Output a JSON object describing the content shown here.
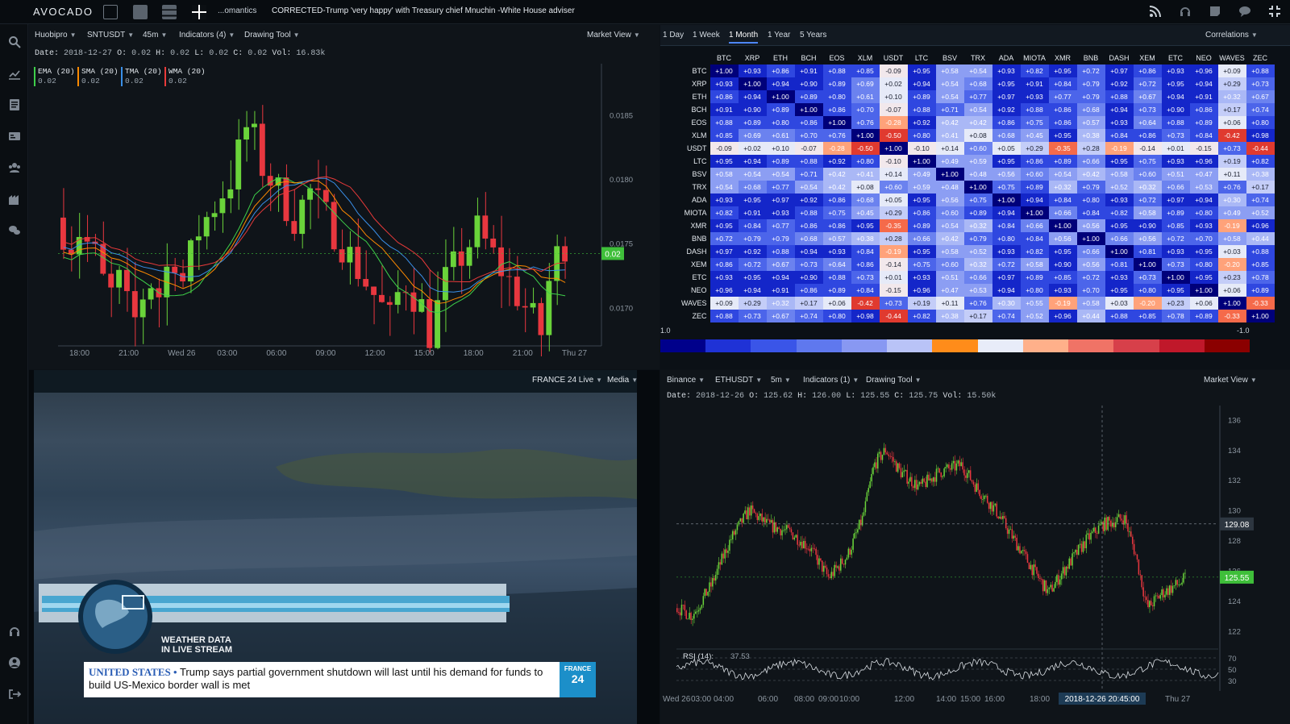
{
  "app": {
    "logo": "AVOCADO"
  },
  "topbar": {
    "news_source": "...omantics",
    "news_headline": "CORRECTED-Trump 'very happy' with Treasury chief Mnuchin -White House adviser"
  },
  "top_left_chart": {
    "exchange": "Huobipro",
    "pair": "SNTUSDT",
    "interval": "45m",
    "indicators": "Indicators (4)",
    "drawing_tool": "Drawing Tool",
    "view": "Market View",
    "ohlc": {
      "date_label": "Date:",
      "date": "2018-12-27",
      "o_label": "O:",
      "o": "0.02",
      "h_label": "H:",
      "h": "0.02",
      "l_label": "L:",
      "l": "0.02",
      "c_label": "C:",
      "c": "0.02",
      "vol_label": "Vol:",
      "vol": "16.83k"
    },
    "legend": [
      {
        "name": "EMA (20)",
        "value": "0.02",
        "color": "#3ecf4a"
      },
      {
        "name": "SMA (20)",
        "value": "0.02",
        "color": "#ff8a00"
      },
      {
        "name": "TMA (20)",
        "value": "0.02",
        "color": "#3a8fe8"
      },
      {
        "name": "WMA (20)",
        "value": "0.02",
        "color": "#e83a3a"
      }
    ],
    "price_labels": [
      "0.0185",
      "0.0180",
      "0.0175",
      "0.0170"
    ],
    "current_price": "0.02",
    "time_labels": [
      "18:00",
      "21:00",
      "Wed 26",
      "03:00",
      "06:00",
      "09:00",
      "12:00",
      "15:00",
      "18:00",
      "21:00",
      "Thu 27"
    ]
  },
  "correlation": {
    "timeframes": [
      "1 Day",
      "1 Week",
      "1 Month",
      "1 Year",
      "5 Years"
    ],
    "active_timeframe": "1 Month",
    "view": "Correlations",
    "symbols": [
      "BTC",
      "XRP",
      "ETH",
      "BCH",
      "EOS",
      "XLM",
      "USDT",
      "LTC",
      "BSV",
      "TRX",
      "ADA",
      "MIOTA",
      "XMR",
      "BNB",
      "DASH",
      "XEM",
      "ETC",
      "NEO",
      "WAVES",
      "ZEC"
    ],
    "matrix": [
      [
        "+1.00",
        "+0.93",
        "+0.86",
        "+0.91",
        "+0.88",
        "+0.85",
        "-0.09",
        "+0.95",
        "+0.58",
        "+0.54",
        "+0.93",
        "+0.82",
        "+0.95",
        "+0.72",
        "+0.97",
        "+0.86",
        "+0.93",
        "+0.96",
        "+0.09",
        "+0.88"
      ],
      [
        "+0.93",
        "+1.00",
        "+0.94",
        "+0.90",
        "+0.89",
        "+0.69",
        "+0.02",
        "+0.94",
        "+0.54",
        "+0.68",
        "+0.95",
        "+0.91",
        "+0.84",
        "+0.79",
        "+0.92",
        "+0.72",
        "+0.95",
        "+0.94",
        "+0.29",
        "+0.73"
      ],
      [
        "+0.86",
        "+0.94",
        "+1.00",
        "+0.89",
        "+0.80",
        "+0.61",
        "+0.10",
        "+0.89",
        "+0.54",
        "+0.77",
        "+0.97",
        "+0.93",
        "+0.77",
        "+0.79",
        "+0.88",
        "+0.67",
        "+0.94",
        "+0.91",
        "+0.32",
        "+0.67"
      ],
      [
        "+0.91",
        "+0.90",
        "+0.89",
        "+1.00",
        "+0.86",
        "+0.70",
        "-0.07",
        "+0.88",
        "+0.71",
        "+0.54",
        "+0.92",
        "+0.88",
        "+0.86",
        "+0.68",
        "+0.94",
        "+0.73",
        "+0.90",
        "+0.86",
        "+0.17",
        "+0.74"
      ],
      [
        "+0.88",
        "+0.89",
        "+0.80",
        "+0.86",
        "+1.00",
        "+0.76",
        "-0.28",
        "+0.92",
        "+0.42",
        "+0.42",
        "+0.86",
        "+0.75",
        "+0.86",
        "+0.57",
        "+0.93",
        "+0.64",
        "+0.88",
        "+0.89",
        "+0.06",
        "+0.80"
      ],
      [
        "+0.85",
        "+0.69",
        "+0.61",
        "+0.70",
        "+0.76",
        "+1.00",
        "-0.50",
        "+0.80",
        "+0.41",
        "+0.08",
        "+0.68",
        "+0.45",
        "+0.95",
        "+0.38",
        "+0.84",
        "+0.86",
        "+0.73",
        "+0.84",
        "-0.42",
        "+0.98"
      ],
      [
        "-0.09",
        "+0.02",
        "+0.10",
        "-0.07",
        "-0.28",
        "-0.50",
        "+1.00",
        "-0.10",
        "+0.14",
        "+0.60",
        "+0.05",
        "+0.29",
        "-0.35",
        "+0.28",
        "-0.19",
        "-0.14",
        "+0.01",
        "-0.15",
        "+0.73",
        "-0.44"
      ],
      [
        "+0.95",
        "+0.94",
        "+0.89",
        "+0.88",
        "+0.92",
        "+0.80",
        "-0.10",
        "+1.00",
        "+0.49",
        "+0.59",
        "+0.95",
        "+0.86",
        "+0.89",
        "+0.66",
        "+0.95",
        "+0.75",
        "+0.93",
        "+0.96",
        "+0.19",
        "+0.82"
      ],
      [
        "+0.58",
        "+0.54",
        "+0.54",
        "+0.71",
        "+0.42",
        "+0.41",
        "+0.14",
        "+0.49",
        "+1.00",
        "+0.48",
        "+0.56",
        "+0.60",
        "+0.54",
        "+0.42",
        "+0.58",
        "+0.60",
        "+0.51",
        "+0.47",
        "+0.11",
        "+0.38"
      ],
      [
        "+0.54",
        "+0.68",
        "+0.77",
        "+0.54",
        "+0.42",
        "+0.08",
        "+0.60",
        "+0.59",
        "+0.48",
        "+1.00",
        "+0.75",
        "+0.89",
        "+0.32",
        "+0.79",
        "+0.52",
        "+0.32",
        "+0.66",
        "+0.53",
        "+0.76",
        "+0.17"
      ],
      [
        "+0.93",
        "+0.95",
        "+0.97",
        "+0.92",
        "+0.86",
        "+0.68",
        "+0.05",
        "+0.95",
        "+0.56",
        "+0.75",
        "+1.00",
        "+0.94",
        "+0.84",
        "+0.80",
        "+0.93",
        "+0.72",
        "+0.97",
        "+0.94",
        "+0.30",
        "+0.74"
      ],
      [
        "+0.82",
        "+0.91",
        "+0.93",
        "+0.88",
        "+0.75",
        "+0.45",
        "+0.29",
        "+0.86",
        "+0.60",
        "+0.89",
        "+0.94",
        "+1.00",
        "+0.66",
        "+0.84",
        "+0.82",
        "+0.58",
        "+0.89",
        "+0.80",
        "+0.49",
        "+0.52"
      ],
      [
        "+0.95",
        "+0.84",
        "+0.77",
        "+0.86",
        "+0.86",
        "+0.95",
        "-0.35",
        "+0.89",
        "+0.54",
        "+0.32",
        "+0.84",
        "+0.66",
        "+1.00",
        "+0.56",
        "+0.95",
        "+0.90",
        "+0.85",
        "+0.93",
        "-0.19",
        "+0.96"
      ],
      [
        "+0.72",
        "+0.79",
        "+0.79",
        "+0.68",
        "+0.57",
        "+0.38",
        "+0.28",
        "+0.66",
        "+0.42",
        "+0.79",
        "+0.80",
        "+0.84",
        "+0.56",
        "+1.00",
        "+0.66",
        "+0.56",
        "+0.72",
        "+0.70",
        "+0.58",
        "+0.44"
      ],
      [
        "+0.97",
        "+0.92",
        "+0.88",
        "+0.94",
        "+0.93",
        "+0.84",
        "-0.19",
        "+0.95",
        "+0.58",
        "+0.52",
        "+0.93",
        "+0.82",
        "+0.95",
        "+0.66",
        "+1.00",
        "+0.81",
        "+0.93",
        "+0.95",
        "+0.03",
        "+0.88"
      ],
      [
        "+0.86",
        "+0.72",
        "+0.67",
        "+0.73",
        "+0.64",
        "+0.86",
        "-0.14",
        "+0.75",
        "+0.60",
        "+0.32",
        "+0.72",
        "+0.58",
        "+0.90",
        "+0.56",
        "+0.81",
        "+1.00",
        "+0.73",
        "+0.80",
        "-0.20",
        "+0.85"
      ],
      [
        "+0.93",
        "+0.95",
        "+0.94",
        "+0.90",
        "+0.88",
        "+0.73",
        "+0.01",
        "+0.93",
        "+0.51",
        "+0.66",
        "+0.97",
        "+0.89",
        "+0.85",
        "+0.72",
        "+0.93",
        "+0.73",
        "+1.00",
        "+0.95",
        "+0.23",
        "+0.78"
      ],
      [
        "+0.96",
        "+0.94",
        "+0.91",
        "+0.86",
        "+0.89",
        "+0.84",
        "-0.15",
        "+0.96",
        "+0.47",
        "+0.53",
        "+0.94",
        "+0.80",
        "+0.93",
        "+0.70",
        "+0.95",
        "+0.80",
        "+0.95",
        "+1.00",
        "+0.06",
        "+0.89"
      ],
      [
        "+0.09",
        "+0.29",
        "+0.32",
        "+0.17",
        "+0.06",
        "-0.42",
        "+0.73",
        "+0.19",
        "+0.11",
        "+0.76",
        "+0.30",
        "+0.55",
        "-0.19",
        "+0.58",
        "+0.03",
        "-0.20",
        "+0.23",
        "+0.06",
        "+1.00",
        "-0.33"
      ],
      [
        "+0.88",
        "+0.73",
        "+0.67",
        "+0.74",
        "+0.80",
        "+0.98",
        "-0.44",
        "+0.82",
        "+0.38",
        "+0.17",
        "+0.74",
        "+0.52",
        "+0.96",
        "+0.44",
        "+0.88",
        "+0.85",
        "+0.78",
        "+0.89",
        "-0.33",
        "+1.00"
      ]
    ],
    "scale_high": "1.0",
    "scale_low": "-1.0",
    "scale_colors": [
      "#00008b",
      "#1f32d6",
      "#3a55e8",
      "#5f78ee",
      "#8898f2",
      "#b9c3f7",
      "#ff8c1a",
      "#e8ecf9",
      "#ffb08a",
      "#f07366",
      "#d7404a",
      "#c0182a",
      "#8b0000"
    ]
  },
  "video": {
    "channel": "FRANCE 24 Live",
    "media": "Media",
    "weather_line1": "WEATHER DATA",
    "weather_line2": "IN LIVE STREAM",
    "ticker_country": "UNITED STATES •",
    "ticker_text": "Trump says partial government shutdown will last until his demand for funds to build US-Mexico border wall is met",
    "logo_line1": "FRANCE",
    "logo_line2": "24"
  },
  "bottom_right_chart": {
    "exchange": "Binance",
    "pair": "ETHUSDT",
    "interval": "5m",
    "indicators": "Indicators (1)",
    "drawing_tool": "Drawing Tool",
    "view": "Market View",
    "ohlc": {
      "date_label": "Date:",
      "date": "2018-12-26",
      "o_label": "O:",
      "o": "125.62",
      "h_label": "H:",
      "h": "126.00",
      "l_label": "L:",
      "l": "125.55",
      "c_label": "C:",
      "c": "125.75",
      "vol_label": "Vol:",
      "vol": "15.50k"
    },
    "price_labels": [
      "136",
      "134",
      "132",
      "130",
      "128",
      "126",
      "124",
      "122"
    ],
    "crosshair_price": "129.08",
    "current_price": "125.55",
    "rsi_label": "RSI (14):",
    "rsi_value": "37.53",
    "rsi_levels": [
      "70",
      "50",
      "30"
    ],
    "time_labels": [
      "Wed 26",
      "03:00",
      "04:00",
      "06:00",
      "08:00",
      "09:00",
      "10:00",
      "12:00",
      "14:00",
      "15:00",
      "16:00",
      "18:00",
      "Thu 27"
    ],
    "crosshair_time": "2018-12-26 20:45:00"
  },
  "colors": {
    "up": "#6ad33a",
    "down": "#e8373f",
    "accent_tab": "#4d86ff",
    "current_price_bg": "#3fbf3a"
  }
}
